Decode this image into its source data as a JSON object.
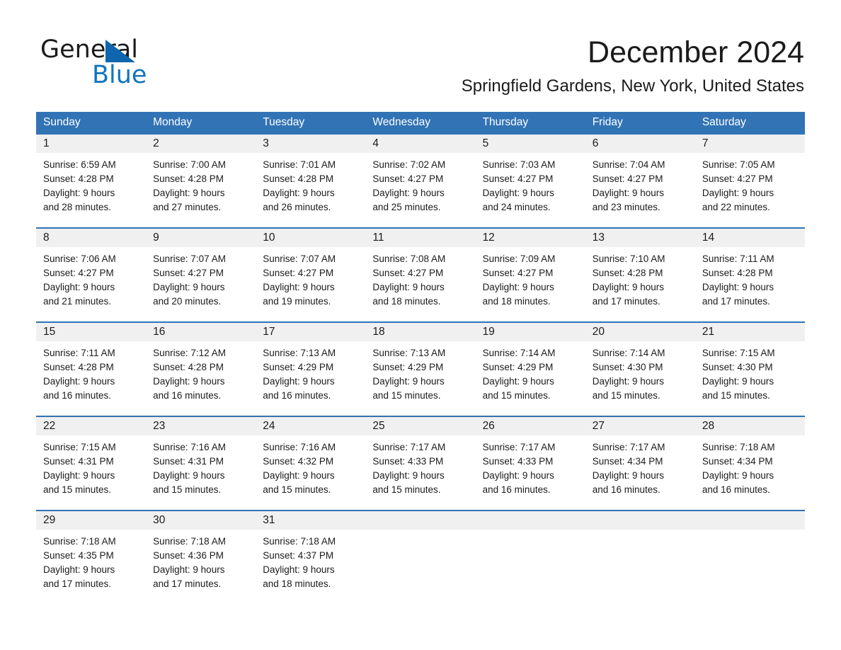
{
  "brand": {
    "word_one": "General",
    "word_two": "Blue",
    "triangle_color": "#1066AE",
    "blue_text_color": "#1275BD"
  },
  "header": {
    "month_title": "December 2024",
    "location": "Springfield Gardens, New York, United States"
  },
  "theme": {
    "header_blue": "#3173B5",
    "date_band_gray": "#F0F0F0",
    "text_color": "#1b1b1b"
  },
  "weekday_headers": [
    "Sunday",
    "Monday",
    "Tuesday",
    "Wednesday",
    "Thursday",
    "Friday",
    "Saturday"
  ],
  "weeks": [
    [
      {
        "day": "1",
        "sunrise": "Sunrise: 6:59 AM",
        "sunset": "Sunset: 4:28 PM",
        "daylight_1": "Daylight: 9 hours",
        "daylight_2": "and 28 minutes."
      },
      {
        "day": "2",
        "sunrise": "Sunrise: 7:00 AM",
        "sunset": "Sunset: 4:28 PM",
        "daylight_1": "Daylight: 9 hours",
        "daylight_2": "and 27 minutes."
      },
      {
        "day": "3",
        "sunrise": "Sunrise: 7:01 AM",
        "sunset": "Sunset: 4:28 PM",
        "daylight_1": "Daylight: 9 hours",
        "daylight_2": "and 26 minutes."
      },
      {
        "day": "4",
        "sunrise": "Sunrise: 7:02 AM",
        "sunset": "Sunset: 4:27 PM",
        "daylight_1": "Daylight: 9 hours",
        "daylight_2": "and 25 minutes."
      },
      {
        "day": "5",
        "sunrise": "Sunrise: 7:03 AM",
        "sunset": "Sunset: 4:27 PM",
        "daylight_1": "Daylight: 9 hours",
        "daylight_2": "and 24 minutes."
      },
      {
        "day": "6",
        "sunrise": "Sunrise: 7:04 AM",
        "sunset": "Sunset: 4:27 PM",
        "daylight_1": "Daylight: 9 hours",
        "daylight_2": "and 23 minutes."
      },
      {
        "day": "7",
        "sunrise": "Sunrise: 7:05 AM",
        "sunset": "Sunset: 4:27 PM",
        "daylight_1": "Daylight: 9 hours",
        "daylight_2": "and 22 minutes."
      }
    ],
    [
      {
        "day": "8",
        "sunrise": "Sunrise: 7:06 AM",
        "sunset": "Sunset: 4:27 PM",
        "daylight_1": "Daylight: 9 hours",
        "daylight_2": "and 21 minutes."
      },
      {
        "day": "9",
        "sunrise": "Sunrise: 7:07 AM",
        "sunset": "Sunset: 4:27 PM",
        "daylight_1": "Daylight: 9 hours",
        "daylight_2": "and 20 minutes."
      },
      {
        "day": "10",
        "sunrise": "Sunrise: 7:07 AM",
        "sunset": "Sunset: 4:27 PM",
        "daylight_1": "Daylight: 9 hours",
        "daylight_2": "and 19 minutes."
      },
      {
        "day": "11",
        "sunrise": "Sunrise: 7:08 AM",
        "sunset": "Sunset: 4:27 PM",
        "daylight_1": "Daylight: 9 hours",
        "daylight_2": "and 18 minutes."
      },
      {
        "day": "12",
        "sunrise": "Sunrise: 7:09 AM",
        "sunset": "Sunset: 4:27 PM",
        "daylight_1": "Daylight: 9 hours",
        "daylight_2": "and 18 minutes."
      },
      {
        "day": "13",
        "sunrise": "Sunrise: 7:10 AM",
        "sunset": "Sunset: 4:28 PM",
        "daylight_1": "Daylight: 9 hours",
        "daylight_2": "and 17 minutes."
      },
      {
        "day": "14",
        "sunrise": "Sunrise: 7:11 AM",
        "sunset": "Sunset: 4:28 PM",
        "daylight_1": "Daylight: 9 hours",
        "daylight_2": "and 17 minutes."
      }
    ],
    [
      {
        "day": "15",
        "sunrise": "Sunrise: 7:11 AM",
        "sunset": "Sunset: 4:28 PM",
        "daylight_1": "Daylight: 9 hours",
        "daylight_2": "and 16 minutes."
      },
      {
        "day": "16",
        "sunrise": "Sunrise: 7:12 AM",
        "sunset": "Sunset: 4:28 PM",
        "daylight_1": "Daylight: 9 hours",
        "daylight_2": "and 16 minutes."
      },
      {
        "day": "17",
        "sunrise": "Sunrise: 7:13 AM",
        "sunset": "Sunset: 4:29 PM",
        "daylight_1": "Daylight: 9 hours",
        "daylight_2": "and 16 minutes."
      },
      {
        "day": "18",
        "sunrise": "Sunrise: 7:13 AM",
        "sunset": "Sunset: 4:29 PM",
        "daylight_1": "Daylight: 9 hours",
        "daylight_2": "and 15 minutes."
      },
      {
        "day": "19",
        "sunrise": "Sunrise: 7:14 AM",
        "sunset": "Sunset: 4:29 PM",
        "daylight_1": "Daylight: 9 hours",
        "daylight_2": "and 15 minutes."
      },
      {
        "day": "20",
        "sunrise": "Sunrise: 7:14 AM",
        "sunset": "Sunset: 4:30 PM",
        "daylight_1": "Daylight: 9 hours",
        "daylight_2": "and 15 minutes."
      },
      {
        "day": "21",
        "sunrise": "Sunrise: 7:15 AM",
        "sunset": "Sunset: 4:30 PM",
        "daylight_1": "Daylight: 9 hours",
        "daylight_2": "and 15 minutes."
      }
    ],
    [
      {
        "day": "22",
        "sunrise": "Sunrise: 7:15 AM",
        "sunset": "Sunset: 4:31 PM",
        "daylight_1": "Daylight: 9 hours",
        "daylight_2": "and 15 minutes."
      },
      {
        "day": "23",
        "sunrise": "Sunrise: 7:16 AM",
        "sunset": "Sunset: 4:31 PM",
        "daylight_1": "Daylight: 9 hours",
        "daylight_2": "and 15 minutes."
      },
      {
        "day": "24",
        "sunrise": "Sunrise: 7:16 AM",
        "sunset": "Sunset: 4:32 PM",
        "daylight_1": "Daylight: 9 hours",
        "daylight_2": "and 15 minutes."
      },
      {
        "day": "25",
        "sunrise": "Sunrise: 7:17 AM",
        "sunset": "Sunset: 4:33 PM",
        "daylight_1": "Daylight: 9 hours",
        "daylight_2": "and 15 minutes."
      },
      {
        "day": "26",
        "sunrise": "Sunrise: 7:17 AM",
        "sunset": "Sunset: 4:33 PM",
        "daylight_1": "Daylight: 9 hours",
        "daylight_2": "and 16 minutes."
      },
      {
        "day": "27",
        "sunrise": "Sunrise: 7:17 AM",
        "sunset": "Sunset: 4:34 PM",
        "daylight_1": "Daylight: 9 hours",
        "daylight_2": "and 16 minutes."
      },
      {
        "day": "28",
        "sunrise": "Sunrise: 7:18 AM",
        "sunset": "Sunset: 4:34 PM",
        "daylight_1": "Daylight: 9 hours",
        "daylight_2": "and 16 minutes."
      }
    ],
    [
      {
        "day": "29",
        "sunrise": "Sunrise: 7:18 AM",
        "sunset": "Sunset: 4:35 PM",
        "daylight_1": "Daylight: 9 hours",
        "daylight_2": "and 17 minutes."
      },
      {
        "day": "30",
        "sunrise": "Sunrise: 7:18 AM",
        "sunset": "Sunset: 4:36 PM",
        "daylight_1": "Daylight: 9 hours",
        "daylight_2": "and 17 minutes."
      },
      {
        "day": "31",
        "sunrise": "Sunrise: 7:18 AM",
        "sunset": "Sunset: 4:37 PM",
        "daylight_1": "Daylight: 9 hours",
        "daylight_2": "and 18 minutes."
      },
      {
        "day": "",
        "sunrise": "",
        "sunset": "",
        "daylight_1": "",
        "daylight_2": ""
      },
      {
        "day": "",
        "sunrise": "",
        "sunset": "",
        "daylight_1": "",
        "daylight_2": ""
      },
      {
        "day": "",
        "sunrise": "",
        "sunset": "",
        "daylight_1": "",
        "daylight_2": ""
      },
      {
        "day": "",
        "sunrise": "",
        "sunset": "",
        "daylight_1": "",
        "daylight_2": ""
      }
    ]
  ]
}
